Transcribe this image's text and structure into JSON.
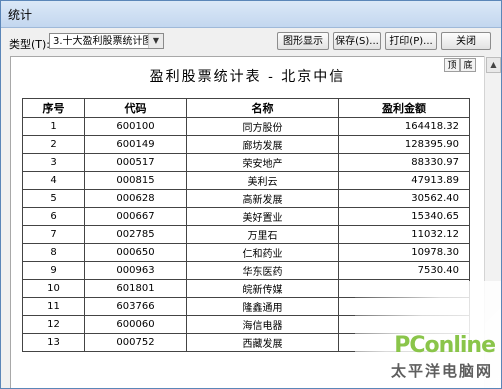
{
  "window": {
    "title": "统计",
    "type_label": "类型(T):",
    "type_value": "3.十大盈利股票统计图"
  },
  "toolbar": {
    "chart_display": "图形显示",
    "save": "保存(S)...",
    "print": "打印(P)...",
    "close": "关闭"
  },
  "report": {
    "title": "盈利股票统计表 - 北京中信",
    "top_label": "顶",
    "bottom_label": "底",
    "headers": [
      "序号",
      "代码",
      "名称",
      "盈利金额"
    ],
    "rows": [
      [
        "1",
        "600100",
        "同方股份",
        "164418.32"
      ],
      [
        "2",
        "600149",
        "廊坊发展",
        "128395.90"
      ],
      [
        "3",
        "000517",
        "荣安地产",
        "88330.97"
      ],
      [
        "4",
        "000815",
        "美利云",
        "47913.89"
      ],
      [
        "5",
        "000628",
        "高新发展",
        "30562.40"
      ],
      [
        "6",
        "000667",
        "美好置业",
        "15340.65"
      ],
      [
        "7",
        "002785",
        "万里石",
        "11032.12"
      ],
      [
        "8",
        "000650",
        "仁和药业",
        "10978.30"
      ],
      [
        "9",
        "000963",
        "华东医药",
        "7530.40"
      ],
      [
        "10",
        "601801",
        "皖新传媒",
        ""
      ],
      [
        "11",
        "603766",
        "隆鑫通用",
        ""
      ],
      [
        "12",
        "600060",
        "海信电器",
        ""
      ],
      [
        "13",
        "000752",
        "西藏发展",
        ""
      ]
    ]
  },
  "watermark": {
    "logo": "PConline",
    "cn": "太平洋电脑网"
  }
}
